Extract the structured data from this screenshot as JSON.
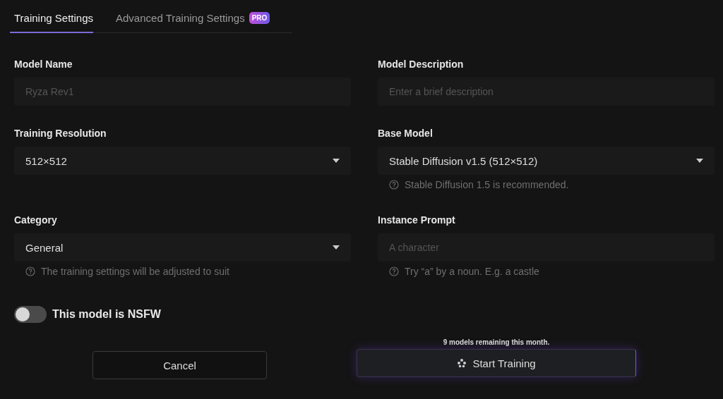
{
  "tabs": [
    {
      "label": "Training Settings",
      "selected": true
    },
    {
      "label": "Advanced Training Settings",
      "selected": false,
      "badge": "PRO"
    }
  ],
  "fields": [
    {
      "label": "Model Name",
      "kind": "text",
      "placeholder": "Ryza Rev1"
    },
    {
      "label": "Model Description",
      "kind": "text",
      "placeholder": "Enter a brief description"
    },
    {
      "label": "Training Resolution",
      "kind": "select",
      "value": "512×512"
    },
    {
      "label": "Base Model",
      "kind": "select",
      "value": "Stable Diffusion v1.5 (512×512)",
      "hint": "Stable Diffusion 1.5 is recommended."
    },
    {
      "label": "Category",
      "kind": "select",
      "value": "General",
      "hint": "The training settings will be adjusted to suit"
    },
    {
      "label": "Instance Prompt",
      "kind": "text",
      "placeholder": "A character",
      "hint": "Try “a” by a noun. E.g. a castle"
    }
  ],
  "nsfw_toggle": {
    "label": "This model is NSFW",
    "on": false
  },
  "remaining": "9 models remaining this month.",
  "cancel_button": "Cancel",
  "start_button": "Start Training"
}
